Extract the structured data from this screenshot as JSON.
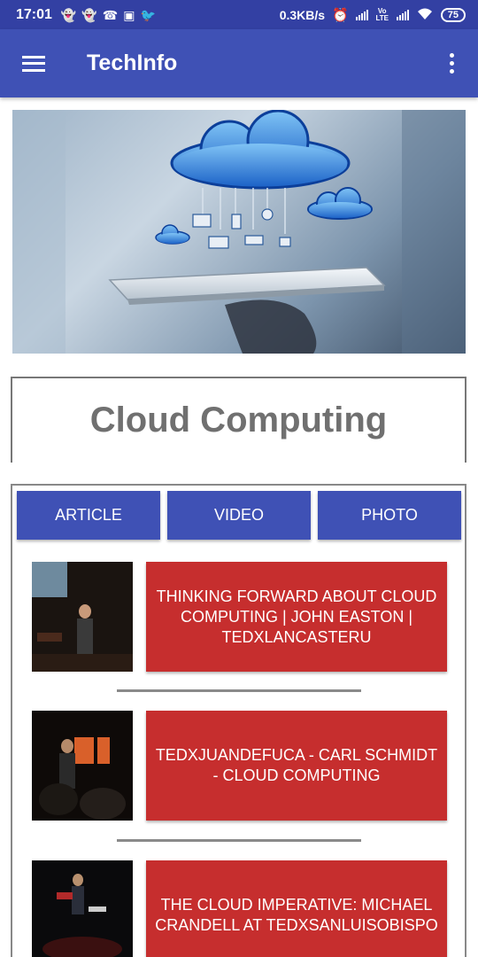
{
  "status_bar": {
    "time": "17:01",
    "net_speed": "0.3KB/s",
    "volte": "Vo LTE",
    "battery": "75",
    "notification_icons": [
      "snapchat-icon",
      "snapchat-icon",
      "whatsapp-icon",
      "app-icon",
      "twitter-icon"
    ]
  },
  "app_bar": {
    "title": "TechInfo"
  },
  "topic": {
    "title": "Cloud Computing"
  },
  "tabs": [
    {
      "label": "ARTICLE"
    },
    {
      "label": "VIDEO"
    },
    {
      "label": "PHOTO"
    }
  ],
  "videos": [
    {
      "title": "THINKING FORWARD ABOUT CLOUD COMPUTING | JOHN EASTON | TEDXLANCASTERU"
    },
    {
      "title": "TEDXJUANDEFUCA - CARL SCHMIDT - CLOUD COMPUTING"
    },
    {
      "title": "THE CLOUD IMPERATIVE: MICHAEL CRANDELL AT TEDXSANLUISOBISPO"
    }
  ],
  "colors": {
    "status_bar": "#3340a3",
    "app_bar": "#3f51b5",
    "tab": "#3f51b5",
    "video_card": "#c62e2e",
    "title_text": "#707070"
  }
}
